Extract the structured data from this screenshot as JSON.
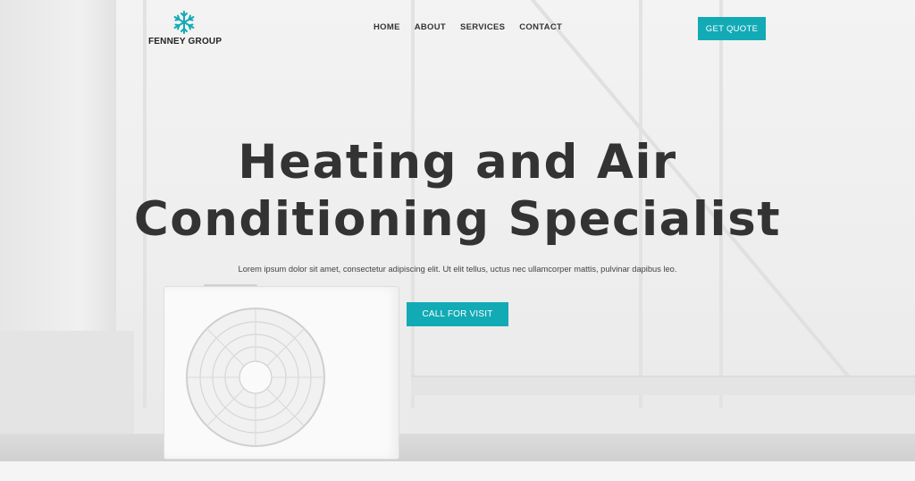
{
  "brand": {
    "name": "FENNEY GROUP",
    "icon": "snowflake-icon",
    "accent_color": "#12aab5"
  },
  "nav": {
    "items": [
      "HOME",
      "ABOUT",
      "SERVICES",
      "CONTACT"
    ]
  },
  "header": {
    "cta_label": "GET QUOTE"
  },
  "hero": {
    "title_line1": "Heating and Air",
    "title_line2": "Conditioning Specialist",
    "description": "Lorem ipsum dolor sit amet, consectetur adipiscing elit. Ut elit tellus, uctus nec ullamcorper mattis, pulvinar dapibus leo.",
    "cta_label": "CALL FOR VISIT",
    "background_image": "air-conditioner-unit-image"
  }
}
